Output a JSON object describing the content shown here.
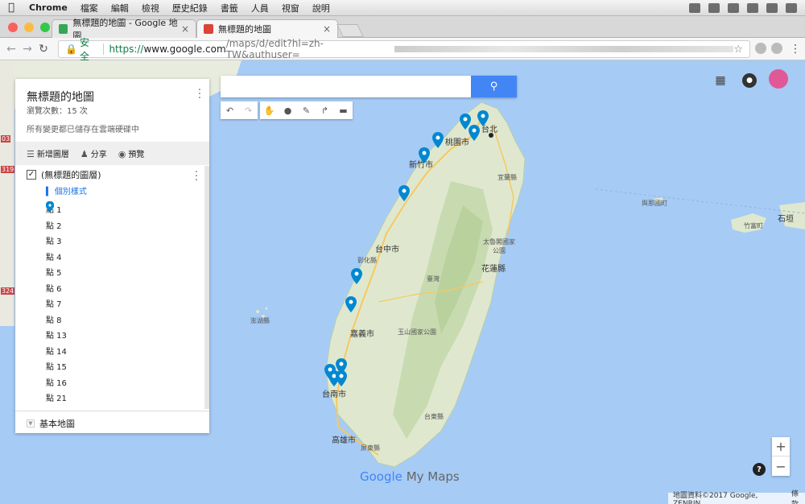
{
  "menubar": {
    "app": "Chrome",
    "items": [
      "檔案",
      "編輯",
      "檢視",
      "歷史紀錄",
      "書籤",
      "人員",
      "視窗",
      "說明"
    ]
  },
  "tabs": [
    {
      "label": "無標題的地圖 - Google 地圖",
      "active": false,
      "close": "×"
    },
    {
      "label": "無標題的地圖",
      "active": true,
      "close": "×"
    }
  ],
  "address": {
    "secure_label": "安全",
    "url_prefix": "https://",
    "url_host": "www.google.com",
    "url_path": "/maps/d/edit?hl=zh-TW&authuser="
  },
  "search": {
    "placeholder": "",
    "button_icon": "search-icon"
  },
  "panel": {
    "title": "無標題的地圖",
    "views": "瀏覽次數：15 次",
    "saved": "所有變更都已儲存在雲端硬碟中",
    "actions": {
      "add_layer": "新增圖層",
      "share": "分享",
      "preview": "預覽"
    },
    "layer_name": "(無標題的圖層)",
    "style_link": "個別樣式",
    "points": [
      "點 1",
      "點 2",
      "點 3",
      "點 4",
      "點 5",
      "點 6",
      "點 7",
      "點 8",
      "點 13",
      "點 14",
      "點 15",
      "點 16",
      "點 21"
    ],
    "base_map": "基本地圖"
  },
  "map": {
    "labels": [
      "台北",
      "桃園市",
      "新竹市",
      "宜蘭縣",
      "台中市",
      "彰化縣",
      "臺灣",
      "花蓮縣",
      "太魯閣國家公園",
      "嘉義市",
      "玉山國家公園",
      "台南市",
      "台東縣",
      "高雄市",
      "澎湖縣",
      "與那國町",
      "竹富町",
      "石垣",
      "屏東縣"
    ],
    "side_numbers": [
      "03",
      "319",
      "324"
    ],
    "logo_google": "Google",
    "logo_mymaps": "My Maps",
    "attribution": "地圖資料©2017 Google, ZENRIN",
    "terms": "條款",
    "zoom_in": "+",
    "zoom_out": "−",
    "help": "?"
  },
  "colors": {
    "accent": "#4285f4",
    "pin": "#0288d1",
    "water": "#a6cbf5",
    "land": "#dfe8cf"
  }
}
